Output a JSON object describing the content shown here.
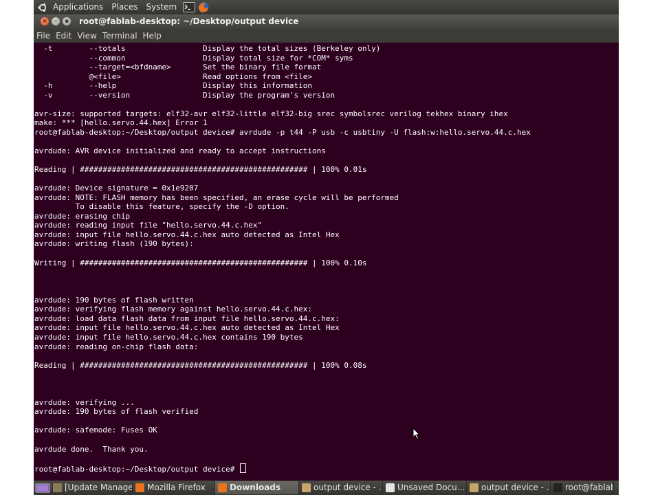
{
  "top_panel": {
    "menus": [
      "Applications",
      "Places",
      "System"
    ]
  },
  "window": {
    "title": "root@fablab-desktop: ~/Desktop/output device"
  },
  "menu_bar": {
    "items": [
      "File",
      "Edit",
      "View",
      "Terminal",
      "Help"
    ]
  },
  "terminal": {
    "lines": [
      "  -t        --totals                 Display the total sizes (Berkeley only)",
      "            --common                 Display total size for *COM* syms",
      "            --target=<bfdname>       Set the binary file format",
      "            @<file>                  Read options from <file>",
      "  -h        --help                   Display this information",
      "  -v        --version                Display the program's version",
      "",
      "avr-size: supported targets: elf32-avr elf32-little elf32-big srec symbolsrec verilog tekhex binary ihex",
      "make: *** [hello.servo.44.hex] Error 1",
      "root@fablab-desktop:~/Desktop/output device# avrdude -p t44 -P usb -c usbtiny -U flash:w:hello.servo.44.c.hex",
      "",
      "avrdude: AVR device initialized and ready to accept instructions",
      "",
      "Reading | ################################################## | 100% 0.01s",
      "",
      "avrdude: Device signature = 0x1e9207",
      "avrdude: NOTE: FLASH memory has been specified, an erase cycle will be performed",
      "         To disable this feature, specify the -D option.",
      "avrdude: erasing chip",
      "avrdude: reading input file \"hello.servo.44.c.hex\"",
      "avrdude: input file hello.servo.44.c.hex auto detected as Intel Hex",
      "avrdude: writing flash (190 bytes):",
      "",
      "Writing | ################################################## | 100% 0.10s",
      "",
      "",
      "",
      "avrdude: 190 bytes of flash written",
      "avrdude: verifying flash memory against hello.servo.44.c.hex:",
      "avrdude: load data flash data from input file hello.servo.44.c.hex:",
      "avrdude: input file hello.servo.44.c.hex auto detected as Intel Hex",
      "avrdude: input file hello.servo.44.c.hex contains 190 bytes",
      "avrdude: reading on-chip flash data:",
      "",
      "Reading | ################################################## | 100% 0.08s",
      "",
      "",
      "",
      "avrdude: verifying ...",
      "avrdude: 190 bytes of flash verified",
      "",
      "avrdude: safemode: Fuses OK",
      "",
      "avrdude done.  Thank you.",
      ""
    ],
    "prompt": "root@fablab-desktop:~/Desktop/output device# "
  },
  "taskbar": {
    "tasks": [
      {
        "label": "[Update Manager]",
        "icon": "update-manager-icon",
        "color": "#8a7a5a"
      },
      {
        "label": "Mozilla Firefox",
        "icon": "firefox-icon",
        "color": "#e8731c"
      },
      {
        "label": "Downloads",
        "icon": "downloads-icon",
        "color": "#e8731c",
        "active": true
      },
      {
        "label": "output device - ...",
        "icon": "image-viewer-icon",
        "color": "#c9a46a"
      },
      {
        "label": "Unsaved Docu...",
        "icon": "text-editor-icon",
        "color": "#e6e6e6"
      },
      {
        "label": "output device - ...",
        "icon": "image-viewer-icon",
        "color": "#c9a46a"
      },
      {
        "label": "root@fablab...",
        "icon": "terminal-icon",
        "color": "#222222"
      }
    ]
  },
  "colors": {
    "terminal_bg": "#2c001e",
    "terminal_fg": "#ffffff",
    "close_button": "#df4a16"
  }
}
